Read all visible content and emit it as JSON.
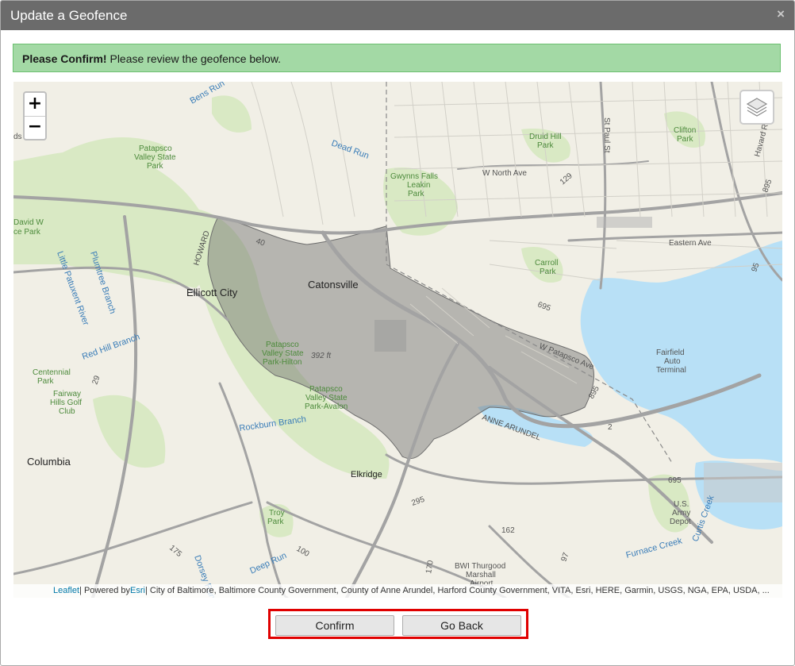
{
  "dialog": {
    "title": "Update a Geofence",
    "close_glyph": "×"
  },
  "alert": {
    "strong": "Please Confirm!",
    "message": " Please review the geofence below."
  },
  "map": {
    "zoom_in": "+",
    "zoom_out": "−",
    "layers_icon": "layers-icon",
    "labels": {
      "catonsville": "Catonsville",
      "ellicott_city": "Ellicott City",
      "columbia": "Columbia",
      "elkridge": "Elkridge",
      "howard": "HOWARD",
      "anne_arundel": "ANNE ARUNDEL",
      "bens_run": "Bens Run",
      "dead_run": "Dead Run",
      "patapsco_park_1": "Patapsco",
      "patapsco_park_2": "Valley State",
      "patapsco_park_3": "Park",
      "gwynns_1": "Gwynns Falls",
      "gwynns_2": "Leakin",
      "gwynns_3": "Park",
      "druid_1": "Druid Hill",
      "druid_2": "Park",
      "clifton_1": "Clifton",
      "clifton_2": "Park",
      "w_north_ave": "W North Ave",
      "eastern_ave": "Eastern Ave",
      "carroll_1": "Carroll",
      "carroll_2": "Park",
      "fairfield_1": "Fairfield",
      "fairfield_2": "Auto",
      "fairfield_3": "Terminal",
      "w_patapsco_ave": "W Patapsco Ave",
      "hilton_1": "Patapsco",
      "hilton_2": "Valley State",
      "hilton_3": "Park-Hilton",
      "elevation": "392 ft",
      "avalon_1": "Patapsco",
      "avalon_2": "Valley State",
      "avalon_3": "Park-Avalon",
      "rockburn": "Rockburn Branch",
      "red_hill": "Red Hill Branch",
      "little_patuxent": "Little Patuxent River",
      "plumtree": "Plumtree Branch",
      "centennial_1": "Centennial",
      "centennial_2": "Park",
      "fairway_1": "Fairway",
      "fairway_2": "Hills Golf",
      "fairway_3": "Club",
      "troy_1": "Troy",
      "troy_2": "Park",
      "army_1": "U.S.",
      "army_2": "Army",
      "army_3": "Depot",
      "bwi_1": "BWI Thurgood",
      "bwi_2": "Marshall",
      "bwi_3": "Airport",
      "deep_run": "Deep Run",
      "dorsey_run": "Dorsey Run",
      "furnace_creek": "Furnace Creek",
      "curtis_creek": "Curtis Creek",
      "st_paul": "St Paul St",
      "havard_rd": "Havard Rd",
      "david_w_1": "David W",
      "david_w_2": "ce Park",
      "rt_40": "40",
      "rt_695": "695",
      "rt_695b": "695",
      "rt_895": "895",
      "rt_895b": "895",
      "rt_95": "95",
      "rt_29": "29",
      "rt_295": "295",
      "rt_175": "175",
      "rt_100": "100",
      "rt_170": "170",
      "rt_97": "97",
      "rt_162": "162",
      "rt_2": "2",
      "rt_129": "129",
      "ds": "ds"
    },
    "attribution": {
      "leaflet": "Leaflet",
      "powered_by": " | Powered by ",
      "esri": "Esri",
      "sources": " | City of Baltimore, Baltimore County Government, County of Anne Arundel, Harford County Government, VITA, Esri, HERE, Garmin, USGS, NGA, EPA, USDA, ..."
    },
    "colors": {
      "land": "#f1efe6",
      "park": "#d8e8c2",
      "water": "#b7dff5",
      "geofence": "#6e6e6e",
      "road": "#a8a8a8"
    }
  },
  "buttons": {
    "confirm": "Confirm",
    "go_back": "Go Back"
  }
}
